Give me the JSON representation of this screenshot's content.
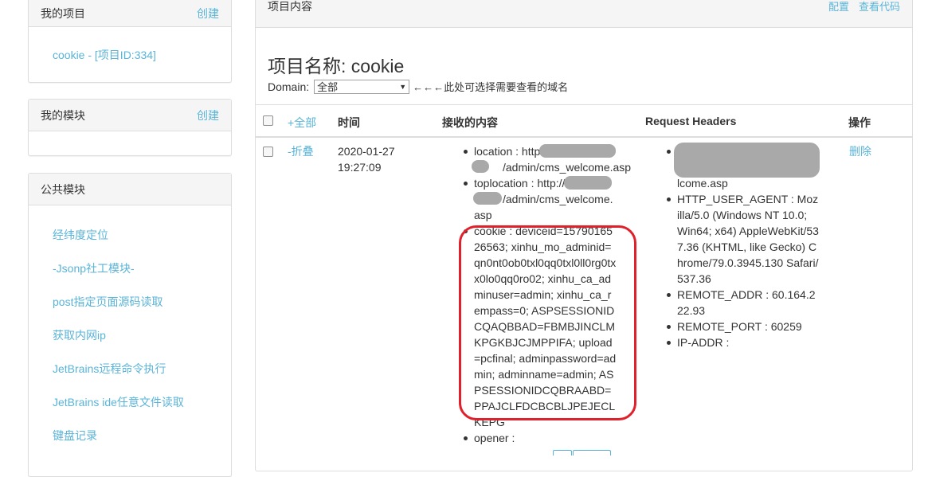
{
  "sidebar": {
    "my_projects": {
      "title": "我的项目",
      "action": "创建",
      "items": [
        "cookie - [项目ID:334]"
      ]
    },
    "my_modules": {
      "title": "我的模块",
      "action": "创建"
    },
    "public_modules": {
      "title": "公共模块",
      "items": [
        "经纬度定位",
        "-Jsonp社工模块-",
        "post指定页面源码读取",
        "获取内网ip",
        "JetBrains远程命令执行",
        "JetBrains ide任意文件读取",
        "键盘记录"
      ]
    }
  },
  "main": {
    "header": {
      "title": "项目内容",
      "config_link": "配置",
      "view_code_link": "查看代码"
    },
    "project_title": "项目名称: cookie",
    "domain": {
      "label": "Domain:",
      "selected": "全部",
      "hint": "←←←此处可选择需要查看的域名"
    },
    "table": {
      "headers": {
        "expand_all": "+全部",
        "time": "时间",
        "content": "接收的内容",
        "request_headers": "Request Headers",
        "actions": "操作"
      },
      "rows": [
        {
          "toggle": "-折叠",
          "date": "2020-01-27",
          "time": "19:27:09",
          "content": [
            "location : http",
            "/admin/cms_welcome.asp",
            "toplocation : http://",
            "/admin/cms_welcome.",
            "asp",
            "cookie : deviceid=15790165",
            "26563; xinhu_mo_adminid=",
            "qn0nt0ob0txl0qq0txl0ll0rg0tx",
            "x0lo0qq0ro02; xinhu_ca_ad",
            "minuser=admin; xinhu_ca_r",
            "empass=0; ASPSESSIONID",
            "CQAQBBAD=FBMBJINCLM",
            "KPGKBJCJMPPIFA; upload",
            "=pcfinal; adminpassword=ad",
            "min; adminname=admin; AS",
            "PSESSIONIDCQBRAABD=",
            "PPAJCLFDCBCBLJPEJECL",
            "KEPG",
            "opener :"
          ],
          "headers": [
            "lcome.asp",
            "HTTP_USER_AGENT : Moz",
            "illa/5.0 (Windows NT 10.0;",
            "Win64; x64) AppleWebKit/53",
            "7.36 (KHTML, like Gecko) C",
            "hrome/79.0.3945.130 Safari/",
            "537.36",
            "REMOTE_ADDR : 60.164.2",
            "22.93",
            "REMOTE_PORT : 60259",
            "IP-ADDR :"
          ],
          "delete": "删除"
        }
      ]
    }
  }
}
